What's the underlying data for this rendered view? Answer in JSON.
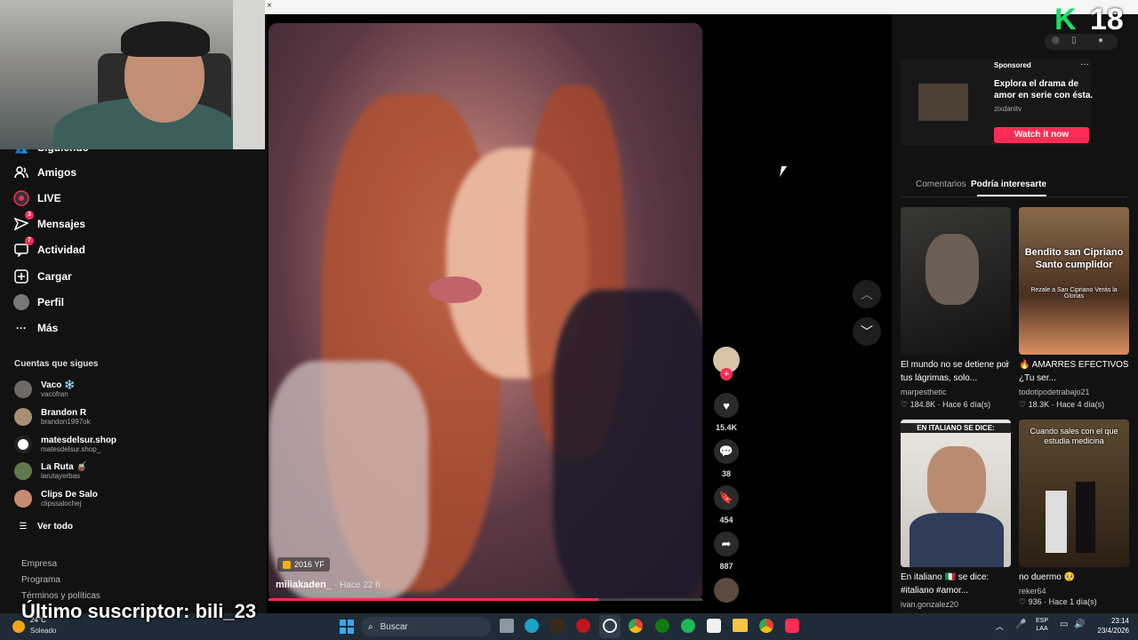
{
  "sidebar": {
    "nav": [
      {
        "label": "Siguiendo",
        "icon": "following-icon"
      },
      {
        "label": "Amigos",
        "icon": "friends-icon"
      },
      {
        "label": "LIVE",
        "icon": "live-icon"
      },
      {
        "label": "Mensajes",
        "icon": "messages-icon",
        "badge": "3"
      },
      {
        "label": "Actividad",
        "icon": "activity-icon",
        "badge": "7"
      },
      {
        "label": "Cargar",
        "icon": "upload-icon"
      },
      {
        "label": "Perfil",
        "icon": "profile-icon"
      },
      {
        "label": "Más",
        "icon": "more-icon"
      }
    ],
    "following_title": "Cuentas que sigues",
    "following": [
      {
        "name": "Vaco ❄️",
        "handle": "vacofran"
      },
      {
        "name": "Brandon R",
        "handle": "brandon1997ok"
      },
      {
        "name": "matesdelsur.shop",
        "handle": "matesdelsur.shop_"
      },
      {
        "name": "La Ruta 🧉",
        "handle": "larutayerbas"
      },
      {
        "name": "Clips De Salo",
        "handle": "clipssalochej"
      }
    ],
    "see_all": "Ver todo",
    "footer": [
      "Empresa",
      "Programa",
      "Términos y políticas"
    ]
  },
  "overlay": {
    "subscriber": "Último suscriptor: bili_23",
    "brand_letter": "K",
    "brand_number": "18"
  },
  "video": {
    "tag": "2016 YF",
    "author": "miiiakaden_",
    "time": "· Hace 22 h",
    "progress": 0.76
  },
  "actions": {
    "likes": "15.4K",
    "comments": "38",
    "saves": "454",
    "shares": "887"
  },
  "ad": {
    "sponsored": "Sponsored",
    "text": "Explora el drama de amor en serie con ésta.",
    "handle": "zixdanitv",
    "cta": "Watch it now"
  },
  "tabs": {
    "comments": "Comentarios",
    "suggested": "Podría interesarte"
  },
  "cards": [
    {
      "caption": "El mundo no se detiene por tus lágrimas, solo...",
      "author": "marpesthetic",
      "likes": "184.8K",
      "time": "Hace 6 día(s)",
      "thumb_text": ""
    },
    {
      "caption": "🔥 AMARRES EFECTIVOS ¿Tu ser...",
      "author": "todotipodetrabajo21",
      "likes": "18.3K",
      "time": "Hace 4 día(s)",
      "thumb_text": "Bendito san Cipriano Santo cumplidor",
      "thumb_sub": "Rezale a San Cipriano Verás la Glorias"
    },
    {
      "caption": "En italiano 🇮🇹 se dice: #italiano #amor...",
      "author": "ivan.gonzalez20",
      "likes": "",
      "time": "",
      "thumb_text": "EN ITALIANO SE DICE:"
    },
    {
      "caption": "no duermo 🥺",
      "author": "reker64",
      "likes": "936",
      "time": "Hace 1 día(s)",
      "thumb_text": "Cuando sales con el que estudia medicina"
    }
  ],
  "taskbar": {
    "weather_temp": "24°C",
    "weather": "Soleado",
    "search": "Buscar",
    "lang1": "ESP",
    "lang2": "LAA",
    "time": "23:14",
    "date": "23/4/2026"
  },
  "colors": {
    "accent": "#fe2c55",
    "brand_green": "#19e06a"
  }
}
